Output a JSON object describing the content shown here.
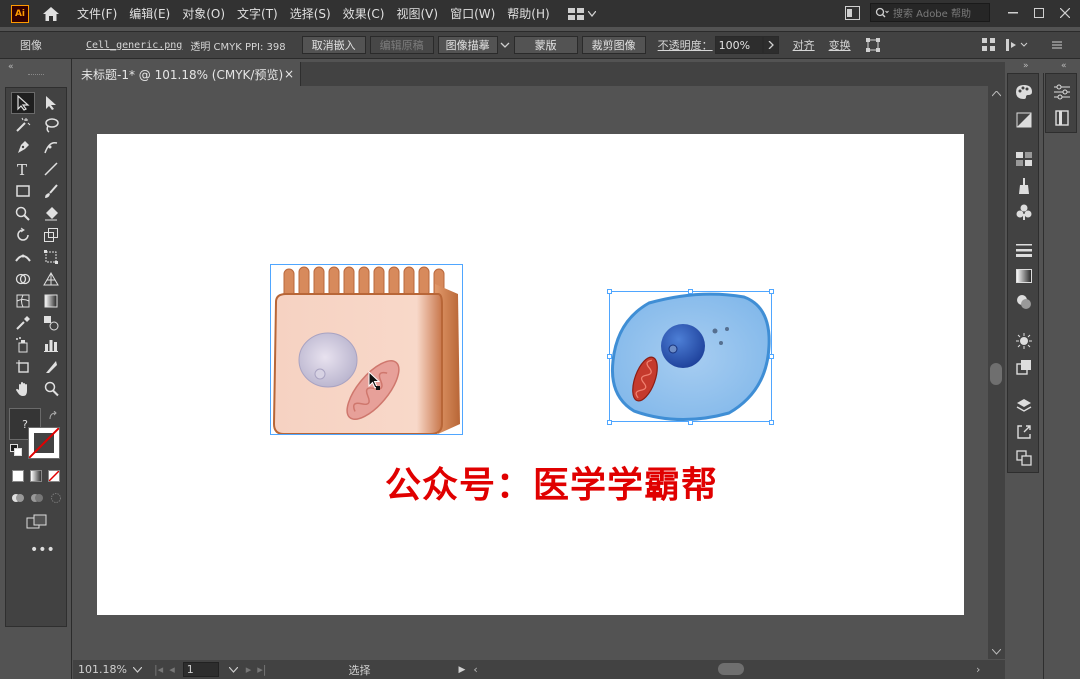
{
  "app": {
    "logo_text": "Ai",
    "menus": [
      "文件(F)",
      "编辑(E)",
      "对象(O)",
      "文字(T)",
      "选择(S)",
      "效果(C)",
      "视图(V)",
      "窗口(W)",
      "帮助(H)"
    ],
    "search_placeholder": "搜索 Adobe 帮助"
  },
  "control_bar": {
    "object_type": "图像",
    "filename": "Cell_generic.png",
    "info": "透明 CMYK PPI: 398",
    "buttons": {
      "unembed": "取消嵌入",
      "edit_original": "编辑原稿",
      "image_trace": "图像描摹",
      "mask": "蒙版",
      "crop_image": "裁剪图像"
    },
    "opacity_label": "不透明度：",
    "opacity_value": "100%",
    "align": "对齐",
    "transform": "变换"
  },
  "document": {
    "tab_title": "未标题-1* @ 101.18% (CMYK/预览)",
    "close_glyph": "×"
  },
  "artboard": {
    "watermark": "公众号：医学学霸帮"
  },
  "status_bar": {
    "zoom": "101.18%",
    "page": "1",
    "status": "选择"
  },
  "colors": {
    "menubar": "#323232",
    "panel": "#424242",
    "canvas": "#535353",
    "artboard": "#ffffff",
    "selection": "#4fa6ff",
    "watermark": "#e00000",
    "logo_orange": "#ff9a00"
  }
}
